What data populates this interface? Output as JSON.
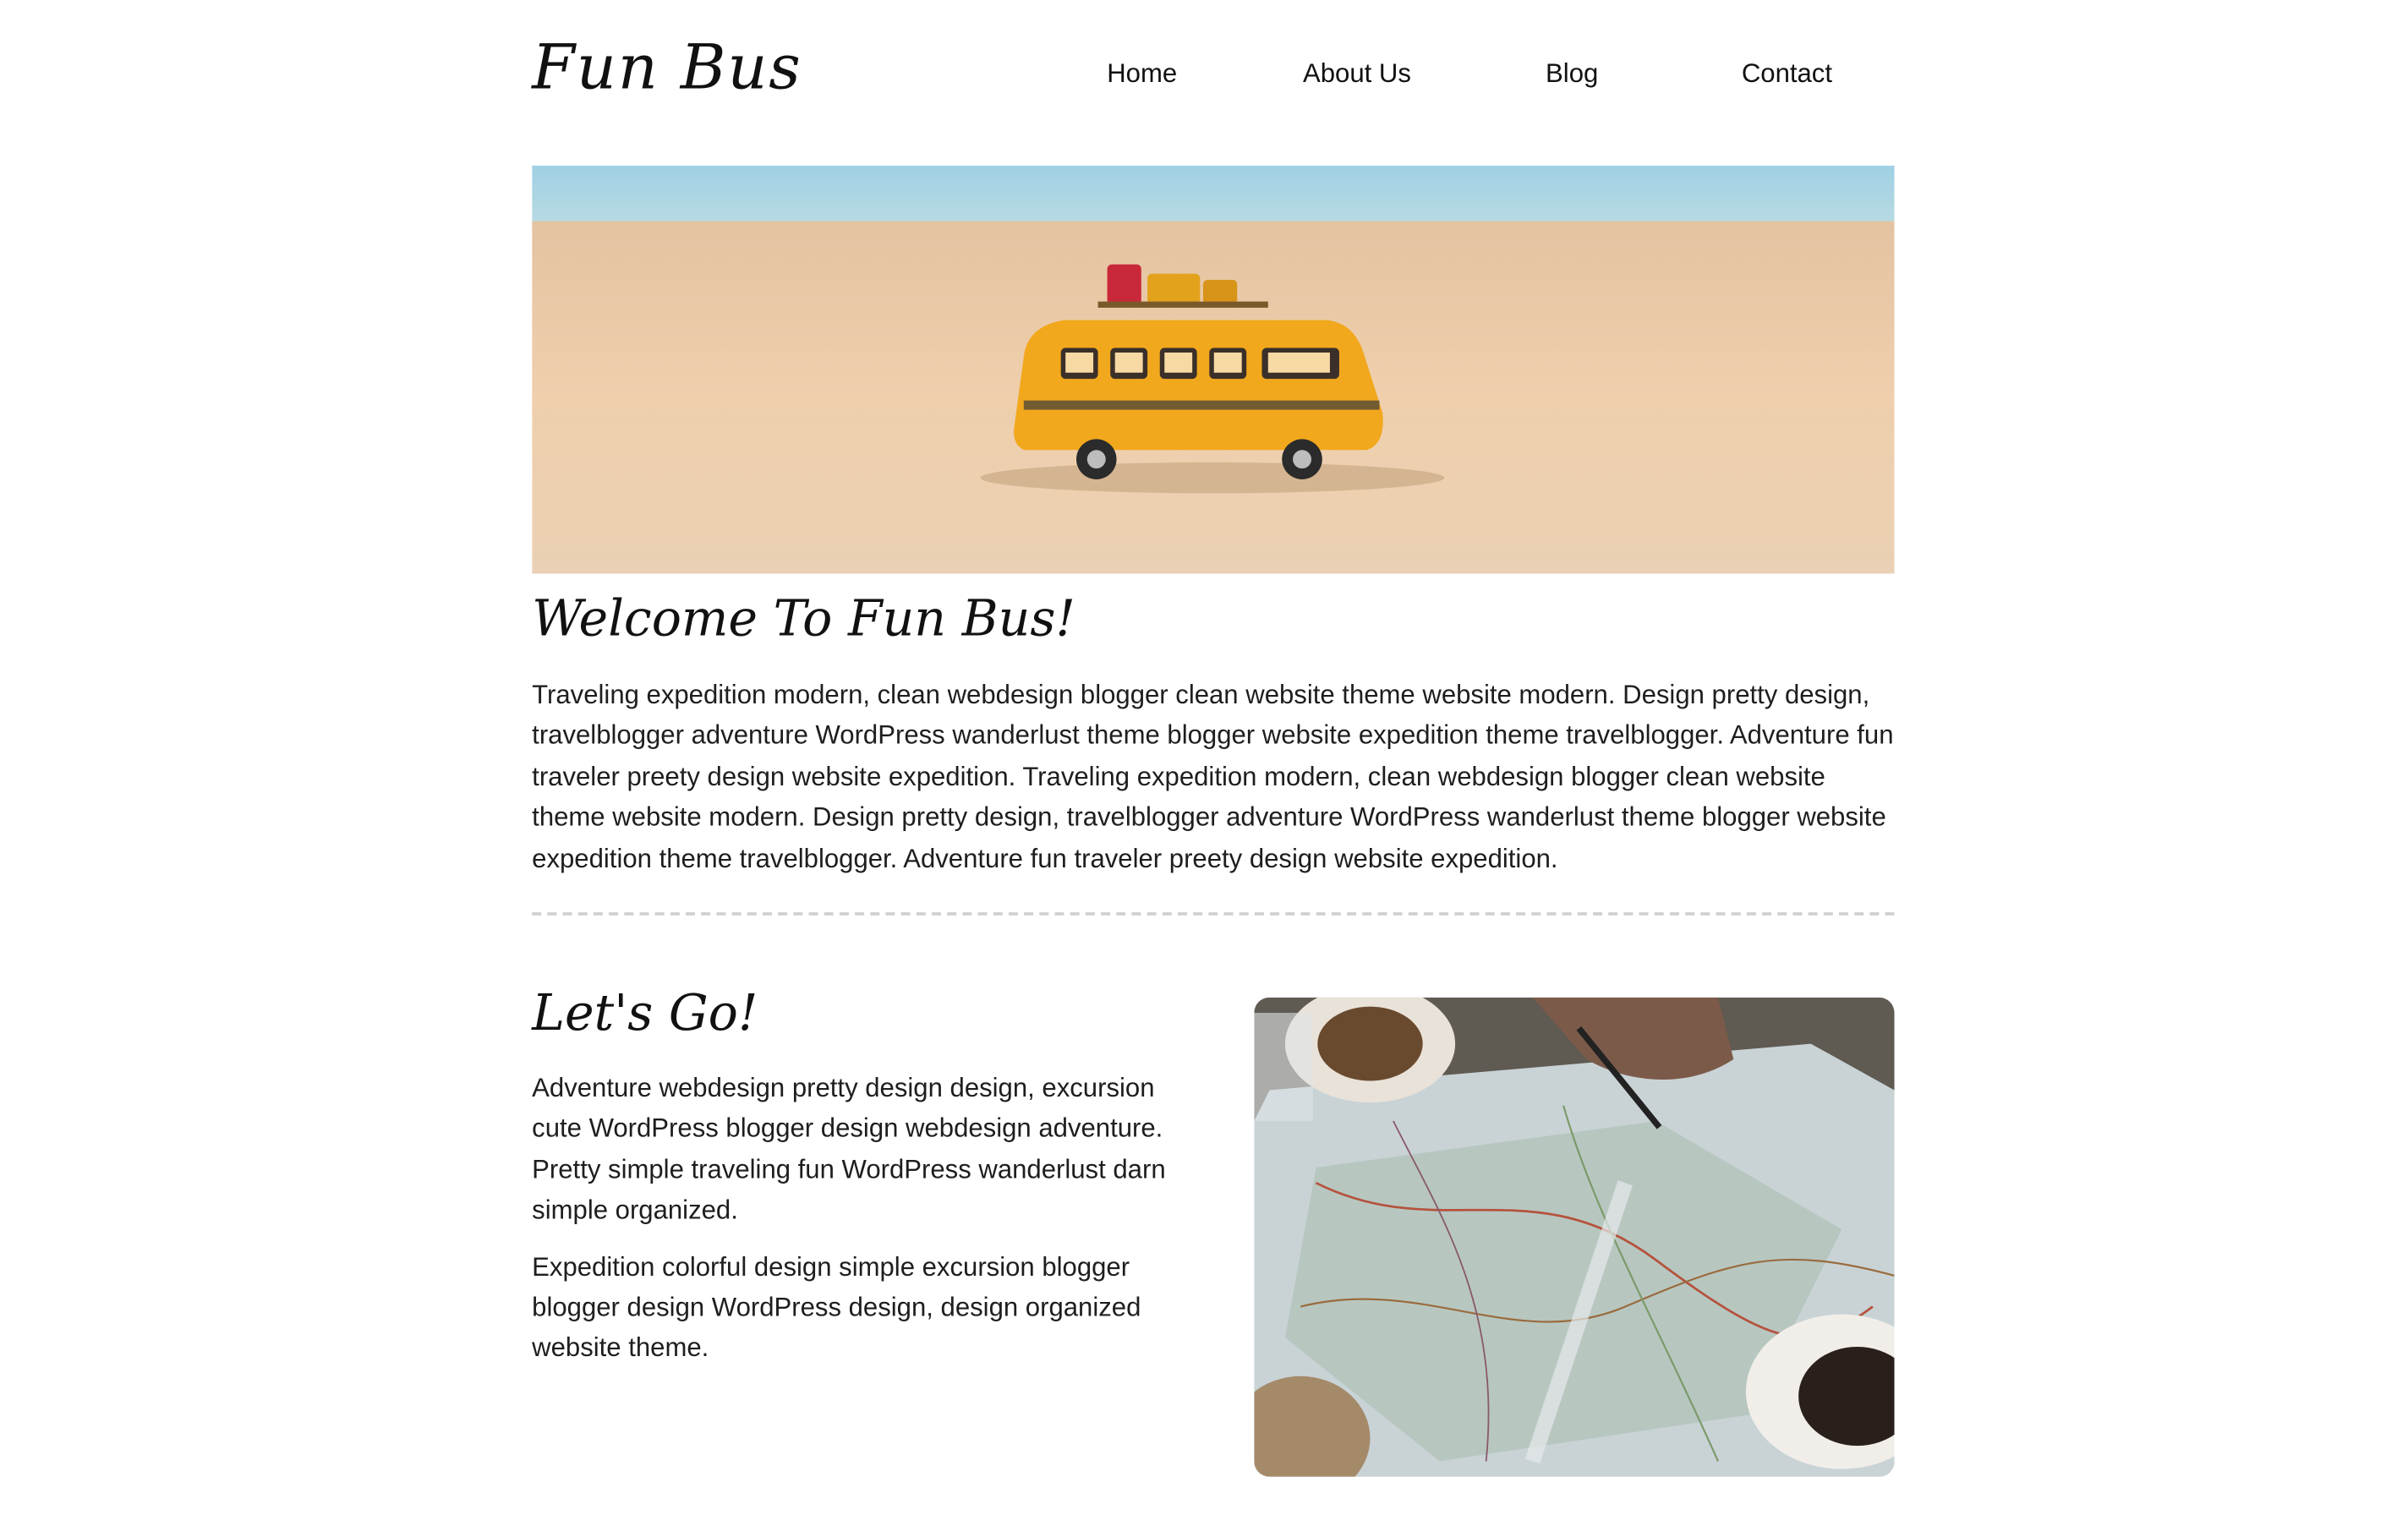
{
  "site": {
    "logo": "Fun Bus"
  },
  "nav": {
    "items": [
      {
        "label": "Home"
      },
      {
        "label": "About Us"
      },
      {
        "label": "Blog"
      },
      {
        "label": "Contact"
      }
    ]
  },
  "welcome": {
    "heading": "Welcome To Fun Bus!",
    "body": "Traveling expedition modern, clean webdesign blogger clean website theme website modern. Design pretty design, travelblogger adventure WordPress wanderlust theme blogger website expedition theme travelblogger. Adventure fun traveler preety design website expedition. Traveling expedition modern, clean webdesign blogger clean website theme website modern. Design pretty design, travelblogger adventure WordPress wanderlust theme blogger website expedition theme travelblogger. Adventure fun traveler preety design website expedition."
  },
  "lets_go": {
    "heading": "Let's Go!",
    "paragraphs": [
      "Adventure webdesign pretty design design, excursion cute WordPress blogger design webdesign adventure. Pretty simple traveling fun WordPress wanderlust darn simple organized.",
      "Expedition colorful design simple excursion blogger blogger design WordPress design, design organized website theme."
    ]
  },
  "colors": {
    "text": "#1e1e1e",
    "divider": "#cfcfcf",
    "sky": "#a8d4e2",
    "sand": "#ecc9a3",
    "bus": "#f2a81d"
  },
  "icons": {
    "hero_image": "yellow-toy-bus-on-beach-image",
    "feature_image": "map-with-coffee-image"
  }
}
